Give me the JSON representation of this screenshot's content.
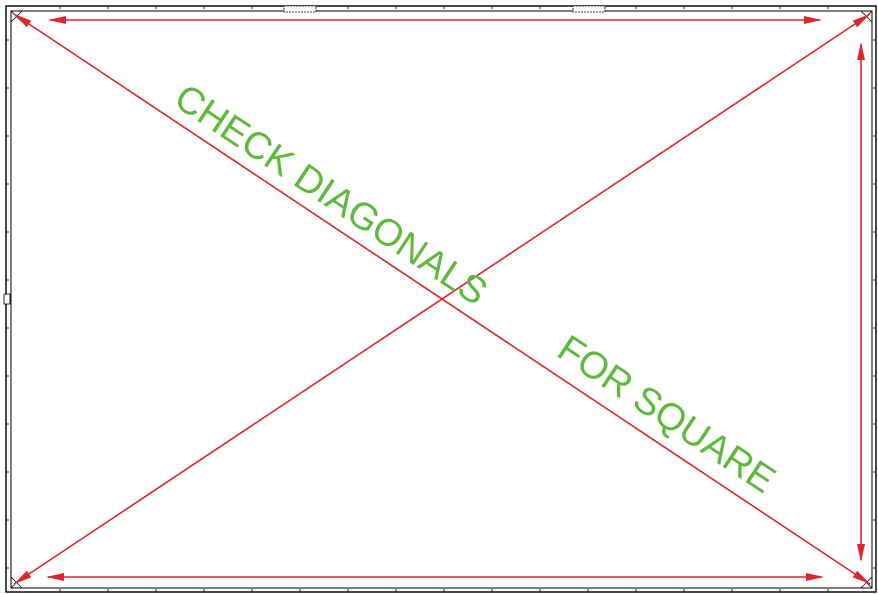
{
  "diagram": {
    "annotations": {
      "line_1": "CHECK DIAGONALS",
      "line_2": "FOR SQUARE"
    },
    "colors": {
      "frame": "#000000",
      "measure_lines": "#e0262b",
      "annotation_text": "#5dba3b",
      "background": "#ffffff"
    },
    "measurements": [
      {
        "id": "diagonal-top-left-to-bottom-right",
        "kind": "diagonal"
      },
      {
        "id": "diagonal-bottom-left-to-top-right",
        "kind": "diagonal"
      },
      {
        "id": "top-width",
        "kind": "horizontal"
      },
      {
        "id": "bottom-width",
        "kind": "horizontal"
      },
      {
        "id": "right-height",
        "kind": "vertical"
      }
    ]
  }
}
